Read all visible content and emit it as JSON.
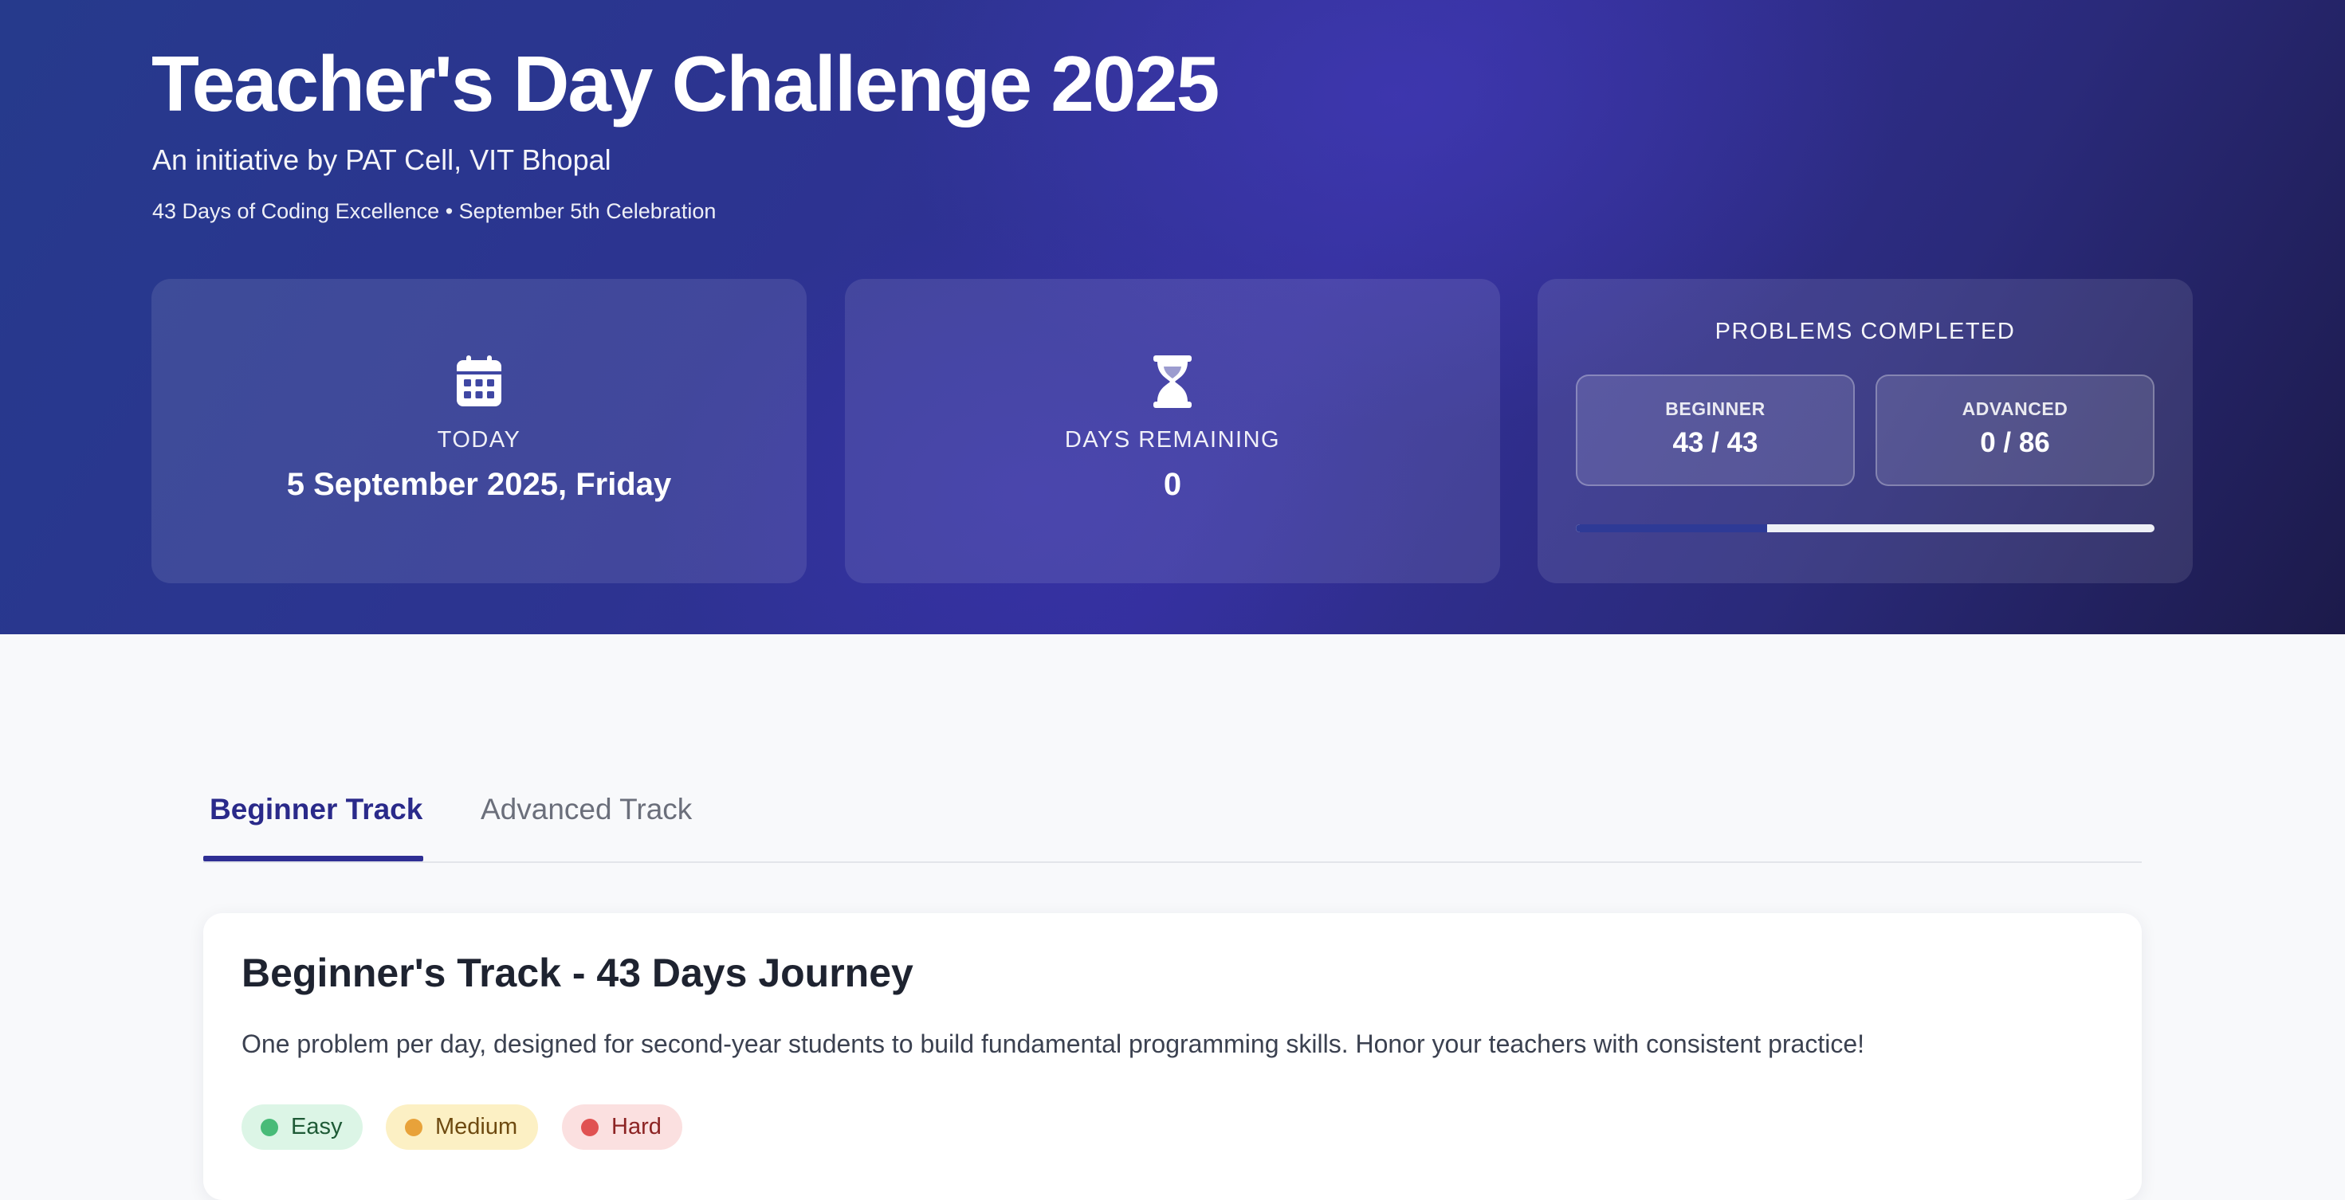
{
  "hero": {
    "title": "Teacher's Day Challenge 2025",
    "subtitle": "An initiative by PAT Cell, VIT Bhopal",
    "meta": "43 Days of Coding Excellence • September 5th Celebration"
  },
  "stats": {
    "today": {
      "icon": "calendar-icon",
      "label": "TODAY",
      "value": "5 September 2025, Friday"
    },
    "days_remaining": {
      "icon": "hourglass-icon",
      "label": "DAYS REMAINING",
      "value": "0"
    },
    "problems": {
      "label": "PROBLEMS COMPLETED",
      "beginner": {
        "label": "BEGINNER",
        "value": "43 / 43"
      },
      "advanced": {
        "label": "ADVANCED",
        "value": "0 / 86"
      },
      "progress_fraction": 0.33
    }
  },
  "tabs": [
    {
      "label": "Beginner Track",
      "active": true
    },
    {
      "label": "Advanced Track",
      "active": false
    }
  ],
  "track": {
    "title": "Beginner's Track - 43 Days Journey",
    "description": "One problem per day, designed for second-year students to build fundamental programming skills. Honor your teachers with consistent practice!",
    "difficulties": [
      {
        "label": "Easy",
        "color": "#48bb78"
      },
      {
        "label": "Medium",
        "color": "#e8a23a"
      },
      {
        "label": "Hard",
        "color": "#e05252"
      }
    ]
  },
  "colors": {
    "accent": "#2f2f94",
    "hero_start": "#263a8c",
    "hero_end": "#1c1a4a"
  }
}
